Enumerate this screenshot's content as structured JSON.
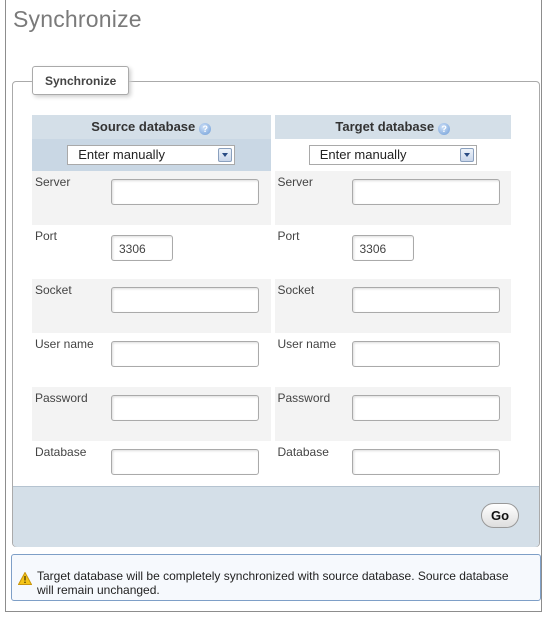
{
  "page": {
    "title": "Synchronize"
  },
  "fieldset": {
    "legend": "Synchronize"
  },
  "source": {
    "header": "Source database",
    "select_value": "Enter manually",
    "fields": [
      {
        "label": "Server",
        "value": ""
      },
      {
        "label": "Port",
        "value": "3306"
      },
      {
        "label": "Socket",
        "value": ""
      },
      {
        "label": "User name",
        "value": ""
      },
      {
        "label": "Password",
        "value": ""
      },
      {
        "label": "Database",
        "value": ""
      }
    ]
  },
  "target": {
    "header": "Target database",
    "select_value": "Enter manually",
    "fields": [
      {
        "label": "Server",
        "value": ""
      },
      {
        "label": "Port",
        "value": "3306"
      },
      {
        "label": "Socket",
        "value": ""
      },
      {
        "label": "User name",
        "value": ""
      },
      {
        "label": "Password",
        "value": ""
      },
      {
        "label": "Database",
        "value": ""
      }
    ]
  },
  "actions": {
    "go_label": "Go"
  },
  "notice": {
    "text": "Target database will be completely synchronized with source database. Source database will remain unchanged."
  },
  "icons": {
    "help": "help-icon",
    "dropdown": "chevron-down-icon",
    "warning": "warning-icon"
  },
  "colors": {
    "header_bg": "#d4dfe8",
    "footer_bg": "#d4dfe8",
    "notice_border": "#7e9fc7"
  }
}
